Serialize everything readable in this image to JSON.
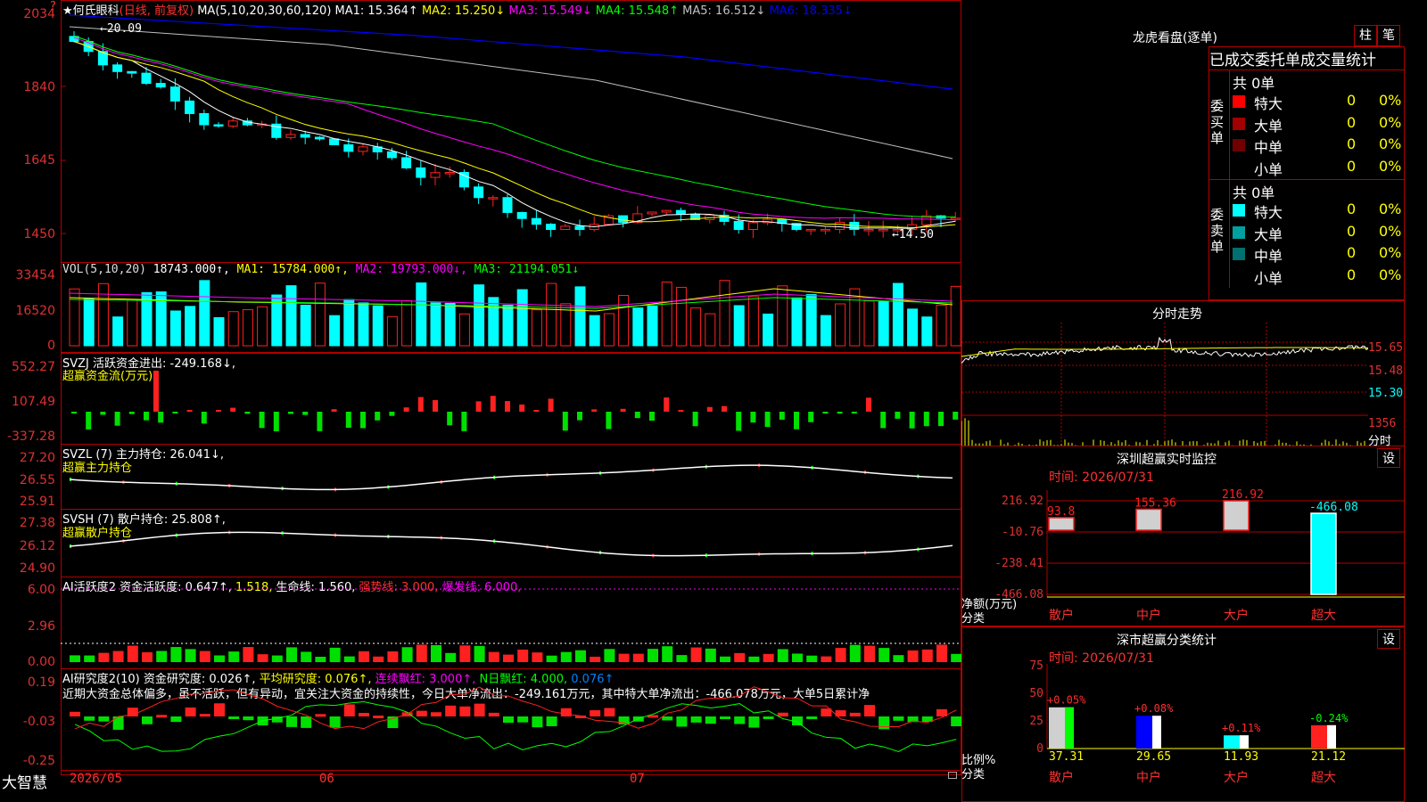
{
  "stock": {
    "name": "★何氏眼科",
    "period": "(日线, 前复权)",
    "ma_params": "MA(5,10,20,30,60,120)",
    "ma": [
      {
        "label": "MA1:",
        "value": "15.364↑",
        "color": "#ffffff"
      },
      {
        "label": "MA2:",
        "value": "15.250↓",
        "color": "#ffff00"
      },
      {
        "label": "MA3:",
        "value": "15.549↓",
        "color": "#ff00ff"
      },
      {
        "label": "MA4:",
        "value": "15.548↑",
        "color": "#00ff00"
      },
      {
        "label": "MA5:",
        "value": "16.512↓",
        "color": "#c0c0c0"
      },
      {
        "label": "MA6:",
        "value": "18.335↓",
        "color": "#0000ff"
      }
    ],
    "price_axis": [
      "2034",
      "1840",
      "1645",
      "1450"
    ],
    "high_label": "←20.09",
    "low_label": "←14.50"
  },
  "vol": {
    "header": "VOL(5,10,20)",
    "value": "18743.000↑,",
    "ma1": "MA1: 15784.000↑,",
    "ma2": "MA2: 19793.000↓,",
    "ma3": "MA3: 21194.051↓",
    "axis": [
      "33454",
      "16520",
      "0"
    ]
  },
  "svzj": {
    "header": "SVZJ  活跃资金进出: -249.168↓,",
    "sub": "超赢资金流(万元)",
    "axis": [
      "552.27",
      "107.49",
      "-337.28"
    ]
  },
  "svzl": {
    "header": "SVZL (7) 主力持仓: 26.041↓,",
    "sub": "超赢主力持仓",
    "axis": [
      "27.20",
      "26.55",
      "25.91"
    ]
  },
  "svsh": {
    "header": "SVSH (7) 散户持仓: 25.808↑,",
    "sub": "超赢散户持仓",
    "axis": [
      "27.38",
      "26.12",
      "24.90"
    ]
  },
  "ai1": {
    "h1": "AI活跃度2 资金活跃度: 0.647↑,",
    "h2": "1.518,",
    "h3": "生命线: 1.560,",
    "h4": "强势线: 3.000,",
    "h5": "爆发线: 6.000,",
    "axis": [
      "6.00",
      "2.96",
      "0.00"
    ]
  },
  "ai2": {
    "h1": "AI研究度2(10) 资金研究度: 0.026↑,",
    "h2": "平均研究度: 0.076↑,",
    "h3": "连续飘红: 3.000↑,",
    "h4": "N日飘红: 4.000,",
    "h5": "0.076↑",
    "comment": "近期大资金总体偏多，虽不活跃，但有异动，宜关注大资金的持续性，今日大单净流出：-249.161万元，其中特大单净流出：-466.078万元，大单5日累计净",
    "axis": [
      "0.19",
      "-0.03",
      "-0.25"
    ]
  },
  "bottom": {
    "brand": "大智慧",
    "dates": [
      "2026/05",
      "06",
      "07"
    ]
  },
  "right": {
    "title": "龙虎看盘(逐单)",
    "btn1": "柱",
    "btn2": "笔",
    "tabs": "已成交委托单成交量统计",
    "buy_label": "委买单",
    "sell_label": "委卖单",
    "buy_total": "共 0单",
    "sell_total": "共 0单",
    "buy_rows": [
      {
        "name": "特大",
        "count": "0",
        "pct": "0%",
        "color": "#ff0000"
      },
      {
        "name": "大单",
        "count": "0",
        "pct": "0%",
        "color": "#a00000"
      },
      {
        "name": "中单",
        "count": "0",
        "pct": "0%",
        "color": "#700000"
      },
      {
        "name": "小单",
        "count": "0",
        "pct": "0%",
        "color": "#000000"
      }
    ],
    "sell_rows": [
      {
        "name": "特大",
        "count": "0",
        "pct": "0%",
        "color": "#00ffff"
      },
      {
        "name": "大单",
        "count": "0",
        "pct": "0%",
        "color": "#00a0a0"
      },
      {
        "name": "中单",
        "count": "0",
        "pct": "0%",
        "color": "#007070"
      },
      {
        "name": "小单",
        "count": "0",
        "pct": "0%",
        "color": "#000000"
      }
    ],
    "intraday_title": "分时走势",
    "intraday_axis": [
      "15.65",
      "15.48",
      "15.30"
    ],
    "intraday_vol": "1356",
    "intraday_unit": "分时",
    "sz_title": "深圳超赢实时监控",
    "sz_time": "时间: 2026/07/31",
    "sz_axis": [
      "216.92",
      "-10.76",
      "-238.41",
      "-466.08"
    ],
    "sz_bars": [
      {
        "cat": "散户",
        "value": 93.8,
        "label": "93.8"
      },
      {
        "cat": "中户",
        "value": 155.36,
        "label": "155.36"
      },
      {
        "cat": "大户",
        "value": 216.92,
        "label": "216.92"
      },
      {
        "cat": "超大",
        "value": -466.08,
        "label": "-466.08"
      }
    ],
    "sz_ylabel": "净额(万元)",
    "sz_xlabel": "分类",
    "set_btn": "设",
    "cls_title": "深市超赢分类统计",
    "cls_time": "时间: 2026/07/31",
    "cls_axis": [
      "75",
      "50",
      "25",
      "0"
    ],
    "cls_bars": [
      {
        "cat": "散户",
        "value": 37.31,
        "label": "37.31",
        "chg": "+0.05%"
      },
      {
        "cat": "中户",
        "value": 29.65,
        "label": "29.65",
        "chg": "+0.08%"
      },
      {
        "cat": "大户",
        "value": 11.93,
        "label": "11.93",
        "chg": "+0.11%"
      },
      {
        "cat": "超大",
        "value": 21.12,
        "label": "21.12",
        "chg": "-0.24%"
      }
    ],
    "cls_ylabel": "比例%",
    "cls_xlabel": "分类"
  },
  "colors": {
    "up": "#ff2020",
    "down": "#00ffff",
    "grid": "#b00000",
    "axis_text": "#e03030"
  }
}
